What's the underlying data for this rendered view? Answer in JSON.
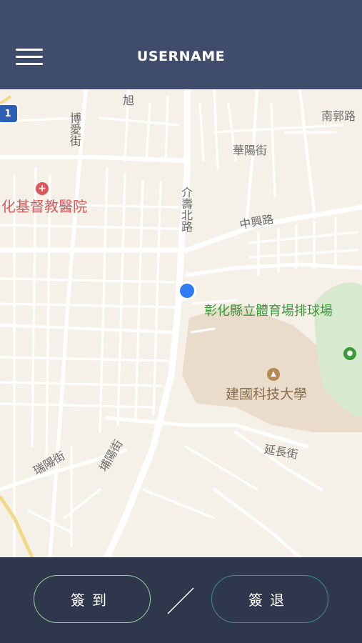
{
  "header": {
    "title": "USERNAME",
    "menu_icon": "hamburger-menu-icon"
  },
  "map": {
    "labels": {
      "nanguo": "南郭路",
      "xu": "旭",
      "boai": "博愛街",
      "huayang": "華陽街",
      "hospital": "化基督教醫院",
      "jieshou": "介壽北路",
      "zhongxing": "中興路",
      "gym": "彰化縣立體育場排球場",
      "university": "建國科技大學",
      "yanchang": "延長街",
      "ruiyang": "瑞陽街",
      "puyang": "埔陽街"
    },
    "route_shield": "1",
    "colors": {
      "hospital": "#d9595b",
      "park": "#3a9a3a",
      "street_text": "#6a6a6a",
      "campus": "#eadccb",
      "park_fill": "#d7ead0",
      "location": "#2f7cf6"
    }
  },
  "footer": {
    "checkin_label": "簽到",
    "checkout_label": "簽退"
  }
}
